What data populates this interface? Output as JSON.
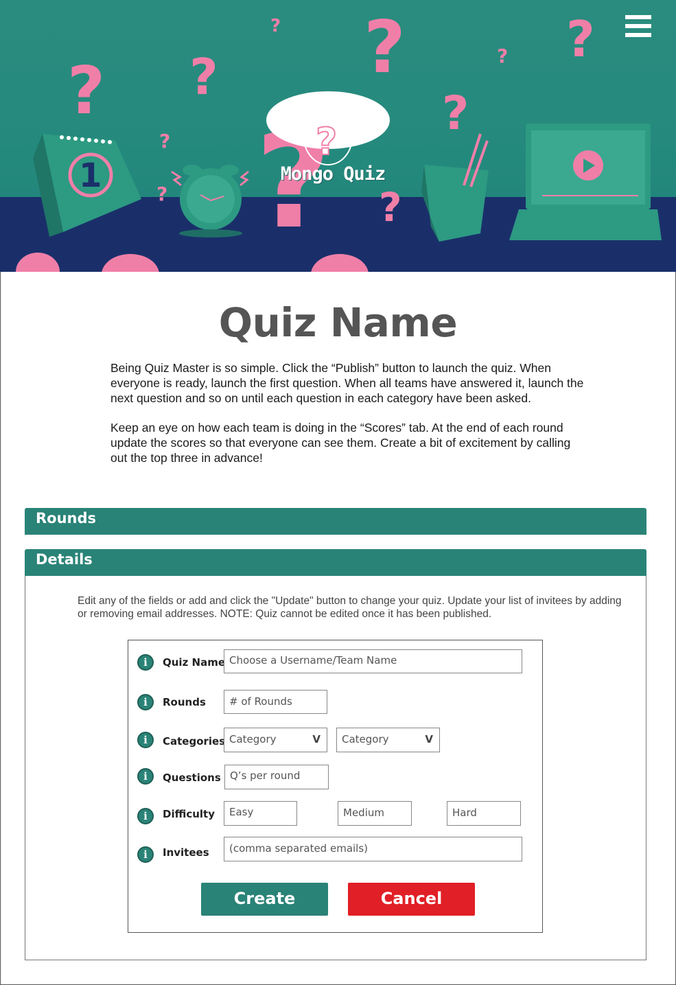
{
  "header": {
    "brand": "Mongo Quiz",
    "menu_icon": "hamburger-menu-icon",
    "calendar_day": "1"
  },
  "page": {
    "title": "Quiz Name",
    "intro": [
      "Being Quiz Master is so simple. Click the “Publish” button to launch the quiz. When everyone is ready, launch the first question. When all teams have answered it, launch the next question and so on until each question in each category have been asked.",
      "Keep an eye on how each team is doing in the “Scores” tab. At the end of each round update the scores so that everyone can see them. Create a bit of excitement by calling out the top three in advance!"
    ]
  },
  "sections": {
    "rounds": "Rounds",
    "details": "Details"
  },
  "details": {
    "note": "Edit any of the fields or add and click the \"Update\" button to change your quiz. Update your list of invitees by adding or removing email addresses. NOTE: Quiz cannot be edited once it has been published.",
    "info_glyph": "i",
    "fields": {
      "quiz_name": {
        "label": "Quiz Name",
        "placeholder": "Choose a Username/Team Name"
      },
      "rounds": {
        "label": "Rounds",
        "placeholder": "# of Rounds"
      },
      "categories": {
        "label": "Categories",
        "option1": "Category",
        "option2": "Category",
        "caret": "V"
      },
      "questions": {
        "label": "Questions",
        "placeholder": "Q’s per round"
      },
      "difficulty": {
        "label": "Difficulty",
        "easy": "Easy",
        "medium": "Medium",
        "hard": "Hard"
      },
      "invitees": {
        "label": "Invitees",
        "placeholder": "(comma separated emails)"
      }
    },
    "buttons": {
      "create": "Create",
      "cancel": "Cancel"
    }
  },
  "colors": {
    "teal": "#2a8377",
    "navy": "#1a2f6a",
    "pink": "#f07fa8",
    "cancel_red": "#e11f26"
  }
}
